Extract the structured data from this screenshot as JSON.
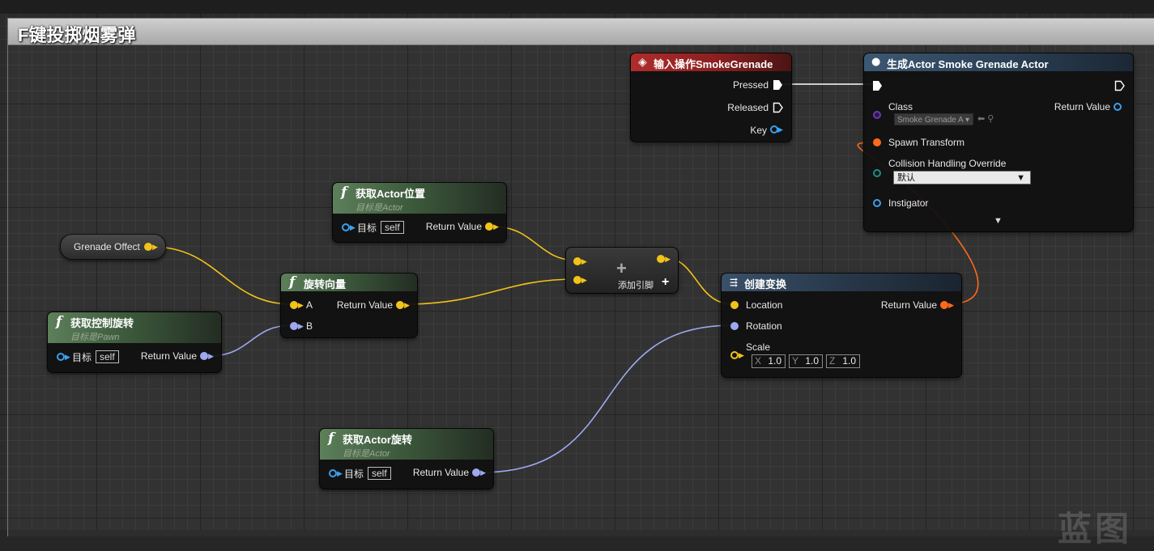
{
  "comment": {
    "title": "F键投掷烟雾弹"
  },
  "nodes": {
    "input_action": {
      "title": "输入操作SmokeGrenade",
      "pins": {
        "pressed": "Pressed",
        "released": "Released",
        "key": "Key"
      }
    },
    "spawn_actor": {
      "title": "生成Actor Smoke Grenade Actor",
      "pins": {
        "class": "Class",
        "class_value": "Smoke Grenade A",
        "spawn_transform": "Spawn Transform",
        "collision": "Collision Handling Override",
        "collision_value": "默认",
        "instigator": "Instigator",
        "return_value": "Return Value"
      }
    },
    "get_actor_location": {
      "title": "获取Actor位置",
      "subtitle": "目标是Actor",
      "pins": {
        "target": "目标",
        "self": "self",
        "return_value": "Return Value"
      }
    },
    "grenade_offect": {
      "label": "Grenade Offect"
    },
    "rotate_vector": {
      "title": "旋转向量",
      "pins": {
        "a": "A",
        "b": "B",
        "return_value": "Return Value"
      }
    },
    "add": {
      "symbol": "+",
      "add_pin": "添加引脚"
    },
    "make_transform": {
      "title": "创建变换",
      "pins": {
        "location": "Location",
        "rotation": "Rotation",
        "scale": "Scale",
        "return_value": "Return Value",
        "x_label": "X",
        "x_value": "1.0",
        "y_label": "Y",
        "y_value": "1.0",
        "z_label": "Z",
        "z_value": "1.0"
      }
    },
    "get_control_rotation": {
      "title": "获取控制旋转",
      "subtitle": "目标是Pawn",
      "pins": {
        "target": "目标",
        "self": "self",
        "return_value": "Return Value"
      }
    },
    "get_actor_rotation": {
      "title": "获取Actor旋转",
      "subtitle": "目标是Actor",
      "pins": {
        "target": "目标",
        "self": "self",
        "return_value": "Return Value"
      }
    }
  },
  "colors": {
    "vector_pin": "#f2c318",
    "rotator_pin": "#9ea8f0",
    "transform_pin": "#ff6a1a",
    "exec_wire": "#ffffff",
    "object_pin": "#3aa0ee"
  },
  "watermark": "蓝图"
}
